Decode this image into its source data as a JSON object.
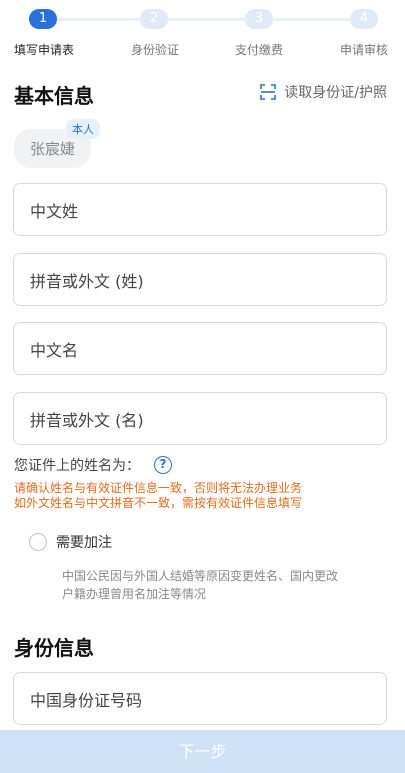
{
  "stepper": {
    "steps": [
      {
        "num": "1",
        "label": "填写申请表"
      },
      {
        "num": "2",
        "label": "身份验证"
      },
      {
        "num": "3",
        "label": "支付缴费"
      },
      {
        "num": "4",
        "label": "申请审核"
      }
    ]
  },
  "basic": {
    "title": "基本信息",
    "read_id_label": "读取身份证/护照",
    "chip_name": "张宸婕",
    "self_tag": "本人"
  },
  "fields": {
    "cn_surname": "中文姓",
    "pinyin_surname": "拼音或外文 (姓)",
    "cn_given": "中文名",
    "pinyin_given": "拼音或外文 (名)"
  },
  "hint": {
    "label": "您证件上的姓名为：",
    "help": "?",
    "warn_line1": "请确认姓名与有效证件信息一致，否则将无法办理业务",
    "warn_line2": "如外文姓名与中文拼音不一致，需按有效证件信息填写"
  },
  "annotation": {
    "label": "需要加注",
    "desc_line1": "中国公民因与外国人结婚等原因变更姓名、国内更改",
    "desc_line2": "户籍办理曾用名加注等情况"
  },
  "identity": {
    "title": "身份信息",
    "id_field": "中国身份证号码"
  },
  "footer": {
    "next_label": "下一步"
  },
  "colors": {
    "accent": "#2a70d8",
    "warning": "#e46a1f"
  }
}
